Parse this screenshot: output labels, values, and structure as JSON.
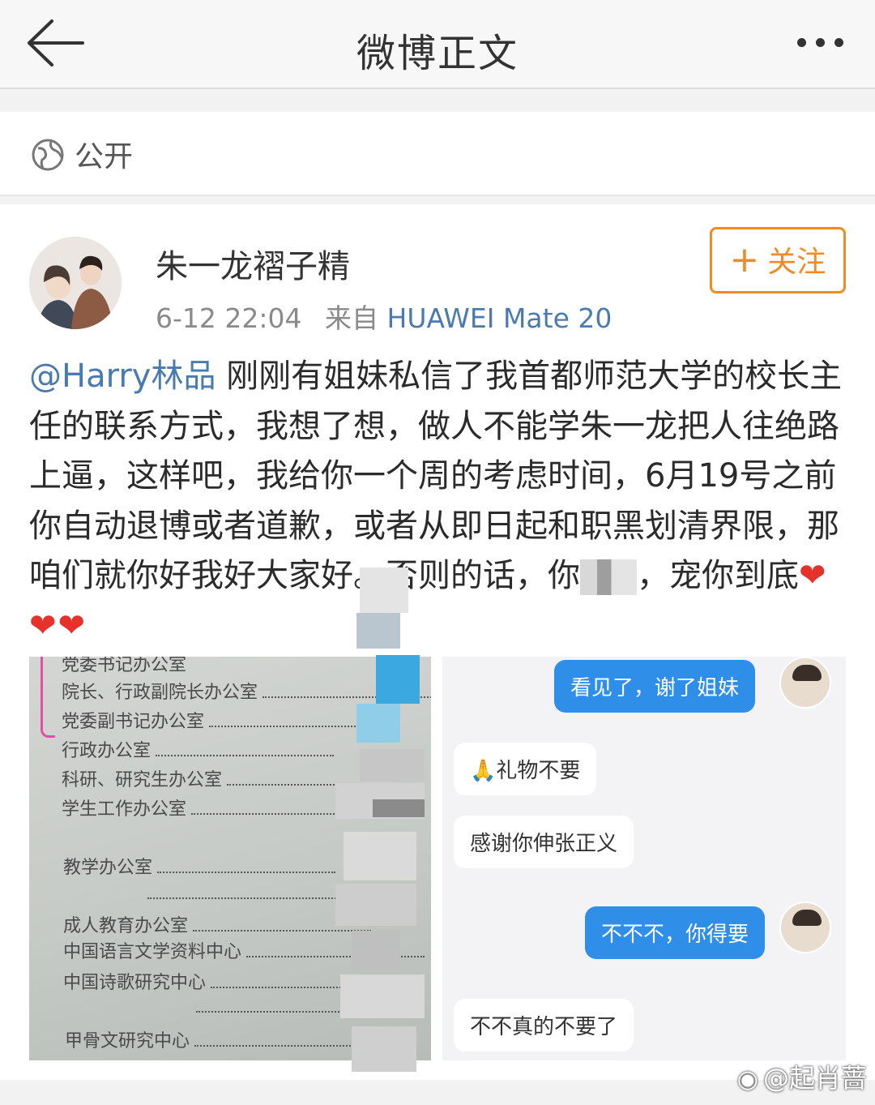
{
  "header": {
    "title": "微博正文",
    "back_icon": "back-arrow-icon",
    "more_icon": "more-dots-icon"
  },
  "visibility": {
    "icon": "globe-icon",
    "label": "公开"
  },
  "post": {
    "author": "朱一龙褶子精",
    "time": "6-12 22:04",
    "source_prefix": "来自",
    "source": "HUAWEI Mate 20",
    "follow_label": "关注",
    "mention": "@Harry林品",
    "text_part1": " 刚刚有姐妹私信了我首都师范大学的校长主任的联系方式，我想了想，做人不能学朱一龙把人往绝路上逼，这样吧，我给你一个周的考虑时间，6月19号之前你自动退博或者道歉，或者从即日起和职黑划清界限，那咱们就你好我好大家好。否则的话，你",
    "text_part2": "，宠你到底",
    "hearts": "❤❤❤"
  },
  "image_left": {
    "lines": [
      "党委书记办公室",
      "院长、行政副院长办公室",
      "党委副书记办公室",
      "行政办公室",
      "科研、研究生办公室",
      "学生工作办公室",
      "教学办公室",
      "成人教育办公室",
      "中国语言文学资料中心",
      "中国诗歌研究中心",
      "甲骨文研究中心"
    ]
  },
  "image_right": {
    "messages": [
      {
        "side": "mine",
        "text": "看见了，谢了姐妹"
      },
      {
        "side": "theirs",
        "text": "🙏礼物不要"
      },
      {
        "side": "theirs",
        "text": "感谢你伸张正义"
      },
      {
        "side": "mine",
        "text": "不不不，你得要"
      },
      {
        "side": "theirs",
        "text": "不不真的不要了"
      }
    ]
  },
  "watermark": {
    "icon": "weibo-logo-icon",
    "text": "@起肖蔷"
  },
  "colors": {
    "accent_orange": "#f08a24",
    "link_blue": "#4a7bb0",
    "chat_blue": "#2e8ee8",
    "heart_red": "#e7322c"
  }
}
